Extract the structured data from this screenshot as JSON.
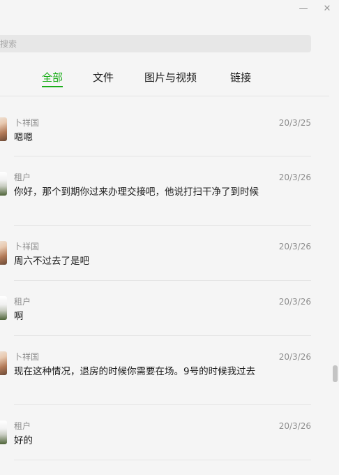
{
  "window": {
    "minimize_glyph": "—",
    "close_glyph": "✕"
  },
  "search": {
    "placeholder": "搜索",
    "value": ""
  },
  "tabs": [
    {
      "label": "全部",
      "active": true
    },
    {
      "label": "文件",
      "active": false
    },
    {
      "label": "图片与视频",
      "active": false
    },
    {
      "label": "链接",
      "active": false
    }
  ],
  "messages": [
    {
      "sender": "卜祥国",
      "date": "20/3/25",
      "text": "嗯嗯",
      "avatar": "avatar-buxiangguo"
    },
    {
      "sender": "租户",
      "date": "20/3/26",
      "text": "你好，那个到期你过来办理交接吧，他说打扫干净了到时候",
      "avatar": "avatar-tenant"
    },
    {
      "sender": "卜祥国",
      "date": "20/3/26",
      "text": "周六不过去了是吧",
      "avatar": "avatar-buxiangguo"
    },
    {
      "sender": "租户",
      "date": "20/3/26",
      "text": "啊",
      "avatar": "avatar-tenant"
    },
    {
      "sender": "卜祥国",
      "date": "20/3/26",
      "text": "现在这种情况，退房的时候你需要在场。9号的时候我过去",
      "avatar": "avatar-buxiangguo"
    },
    {
      "sender": "租户",
      "date": "20/3/26",
      "text": "好的",
      "avatar": "avatar-tenant"
    }
  ],
  "colors": {
    "accent": "#1aad19",
    "background": "#f5f5f5",
    "divider": "#e4e4e4",
    "muted_text": "#8e8e8e"
  }
}
